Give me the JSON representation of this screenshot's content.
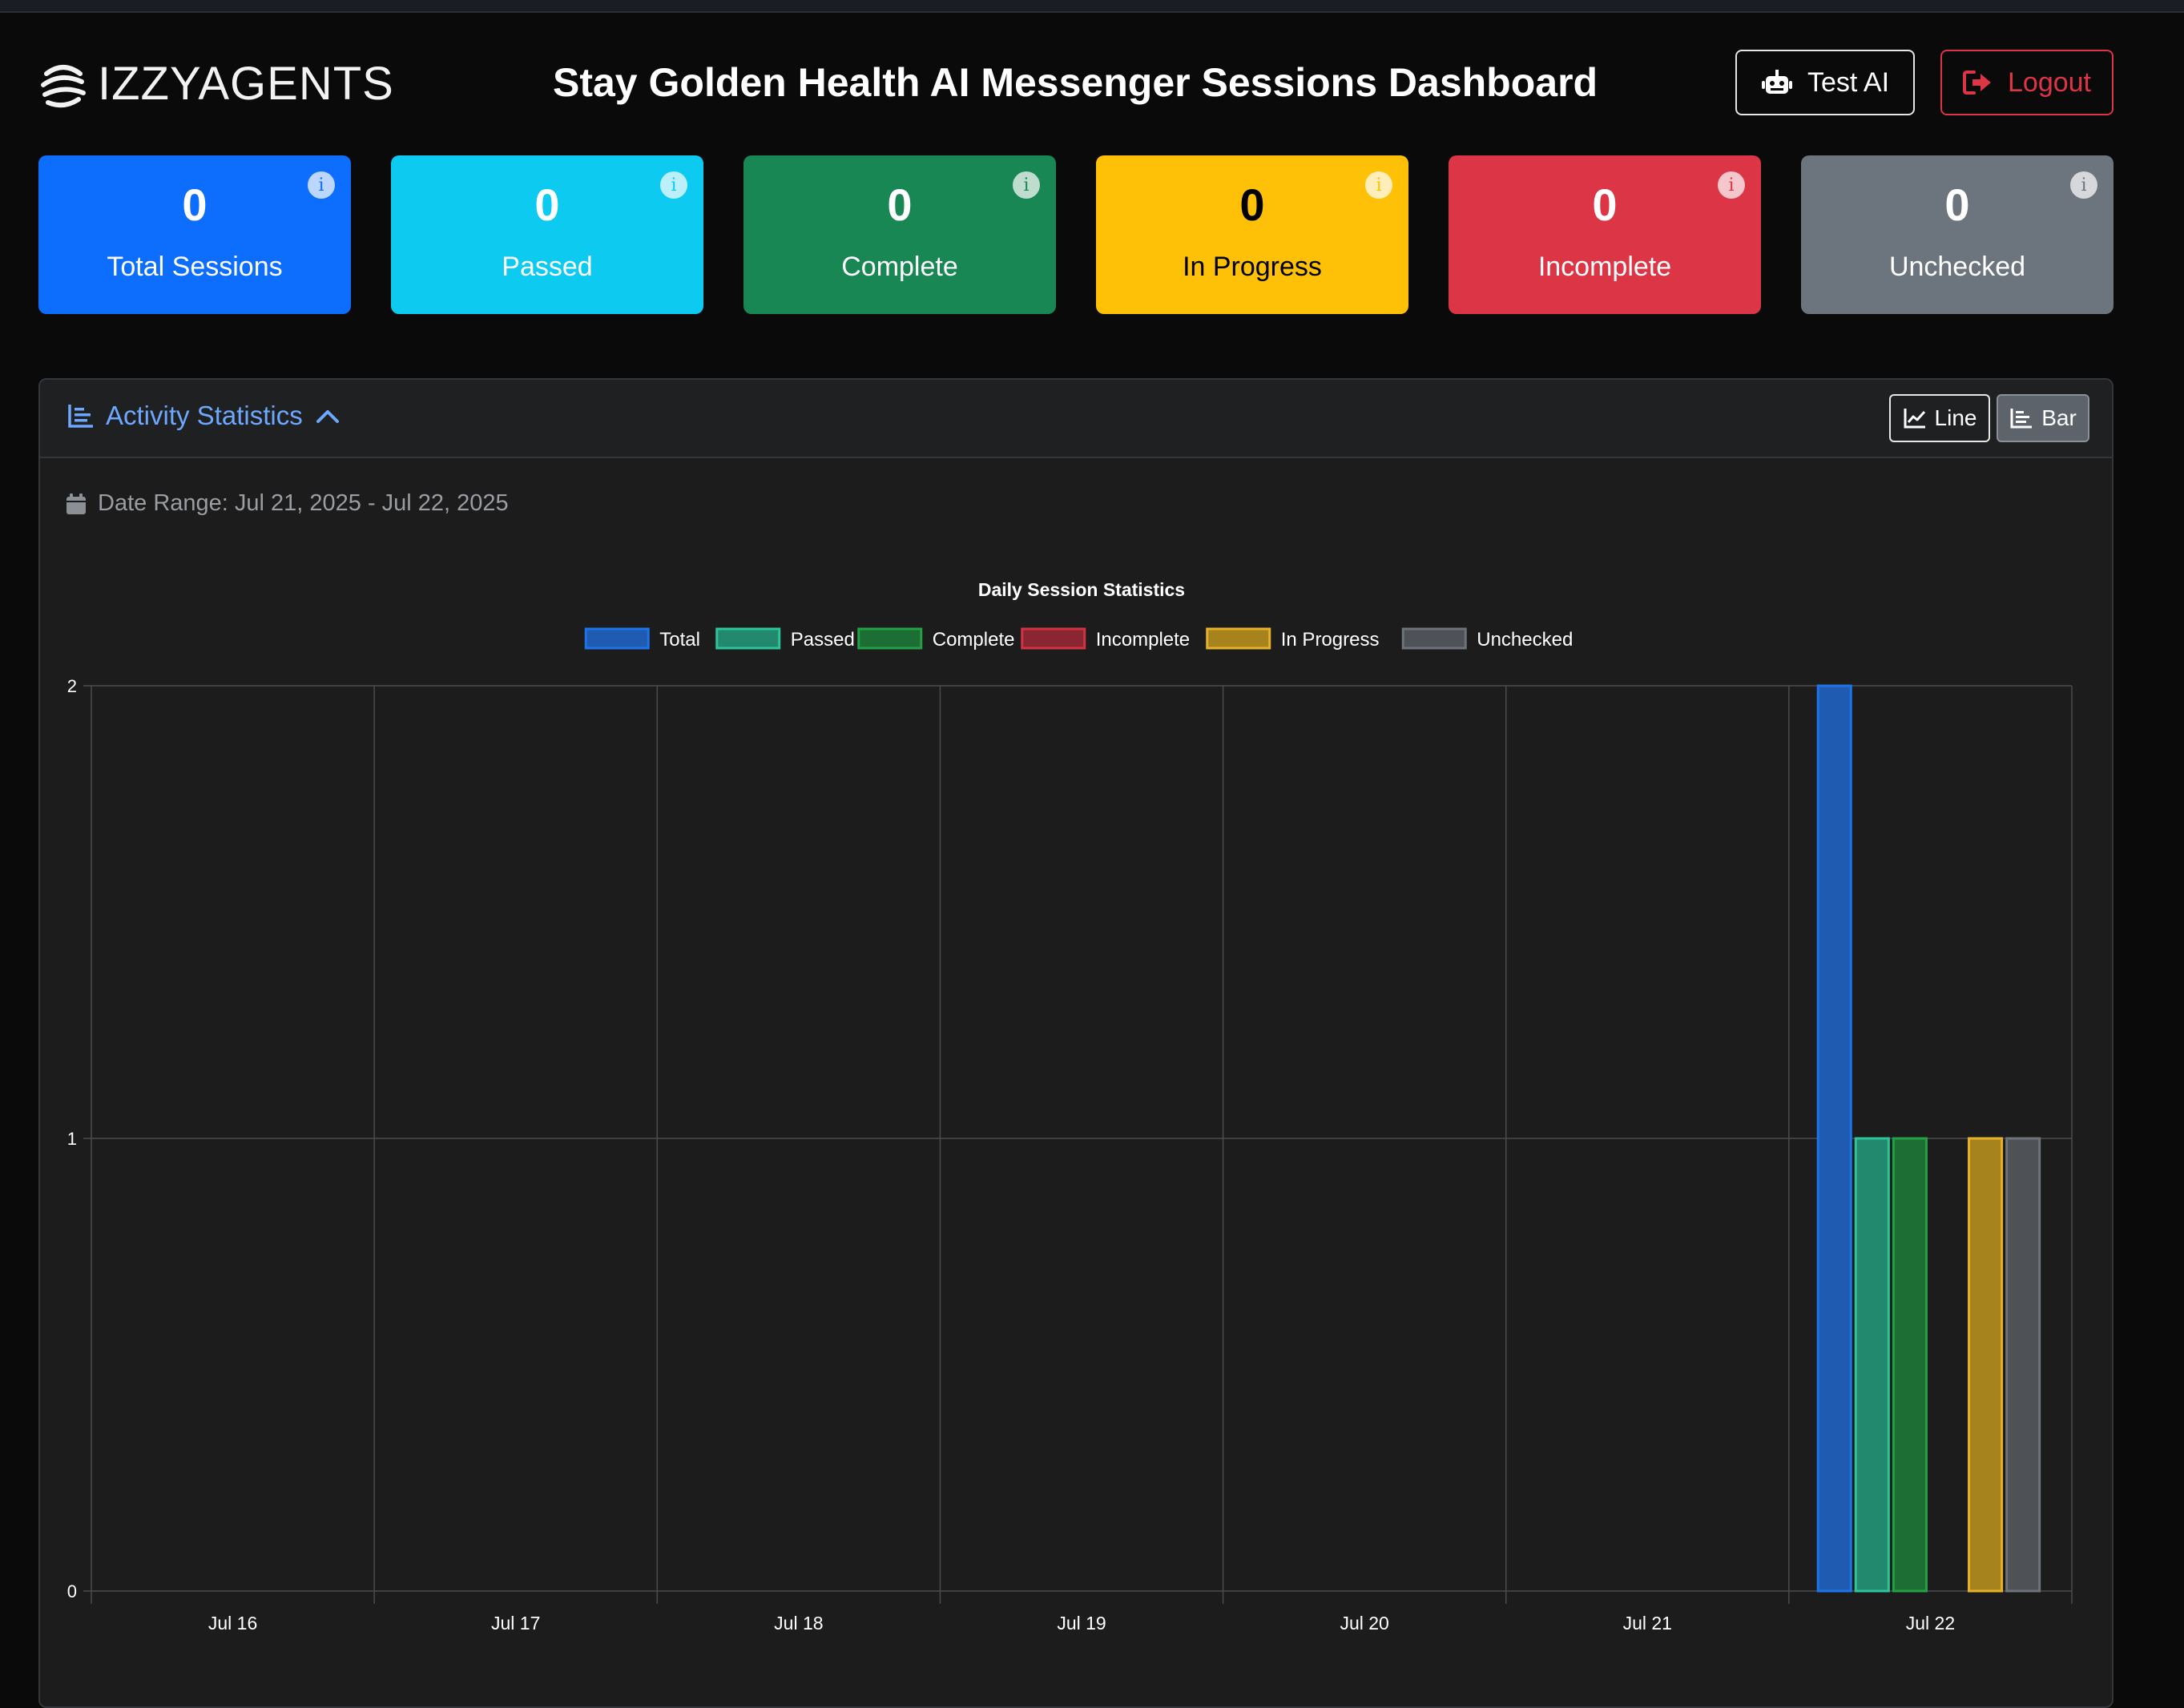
{
  "brand": {
    "name": "IZZYAGENTS"
  },
  "header": {
    "title": "Stay Golden Health AI Messenger Sessions Dashboard"
  },
  "buttons": {
    "test_ai": "Test AI",
    "logout": "Logout"
  },
  "cards": [
    {
      "value": "0",
      "label": "Total Sessions",
      "color": "#0d6efd",
      "text": "#ffffff"
    },
    {
      "value": "0",
      "label": "Passed",
      "color": "#0dcaf0",
      "text": "#ffffff"
    },
    {
      "value": "0",
      "label": "Complete",
      "color": "#198754",
      "text": "#ffffff"
    },
    {
      "value": "0",
      "label": "In Progress",
      "color": "#ffc107",
      "text": "#000000"
    },
    {
      "value": "0",
      "label": "Incomplete",
      "color": "#dc3545",
      "text": "#ffffff"
    },
    {
      "value": "0",
      "label": "Unchecked",
      "color": "#6c757d",
      "text": "#ffffff"
    }
  ],
  "panel": {
    "title": "Activity Statistics",
    "toggle_line": "Line",
    "toggle_bar": "Bar",
    "date_range": "Date Range: Jul 21, 2025 - Jul 22, 2025"
  },
  "chart_data": {
    "type": "bar",
    "title": "Daily Session Statistics",
    "categories": [
      "Jul 16",
      "Jul 17",
      "Jul 18",
      "Jul 19",
      "Jul 20",
      "Jul 21",
      "Jul 22"
    ],
    "ylim": [
      0,
      2
    ],
    "yticks": [
      "0",
      "1",
      "2"
    ],
    "grid": true,
    "legend_position": "top",
    "series": [
      {
        "name": "Total",
        "color": "#1f5bb0",
        "border": "#1e73e8",
        "values": [
          0,
          0,
          0,
          0,
          0,
          0,
          2
        ]
      },
      {
        "name": "Passed",
        "color": "#23896e",
        "border": "#2ec49a",
        "values": [
          0,
          0,
          0,
          0,
          0,
          0,
          1
        ]
      },
      {
        "name": "Complete",
        "color": "#1c6e34",
        "border": "#23a046",
        "values": [
          0,
          0,
          0,
          0,
          0,
          0,
          1
        ]
      },
      {
        "name": "Incomplete",
        "color": "#8a2631",
        "border": "#d23344",
        "values": [
          0,
          0,
          0,
          0,
          0,
          0,
          0
        ]
      },
      {
        "name": "In Progress",
        "color": "#a7831e",
        "border": "#e6b12a",
        "values": [
          0,
          0,
          0,
          0,
          0,
          0,
          1
        ]
      },
      {
        "name": "Unchecked",
        "color": "#4e5257",
        "border": "#6d7379",
        "values": [
          0,
          0,
          0,
          0,
          0,
          0,
          1
        ]
      }
    ]
  }
}
